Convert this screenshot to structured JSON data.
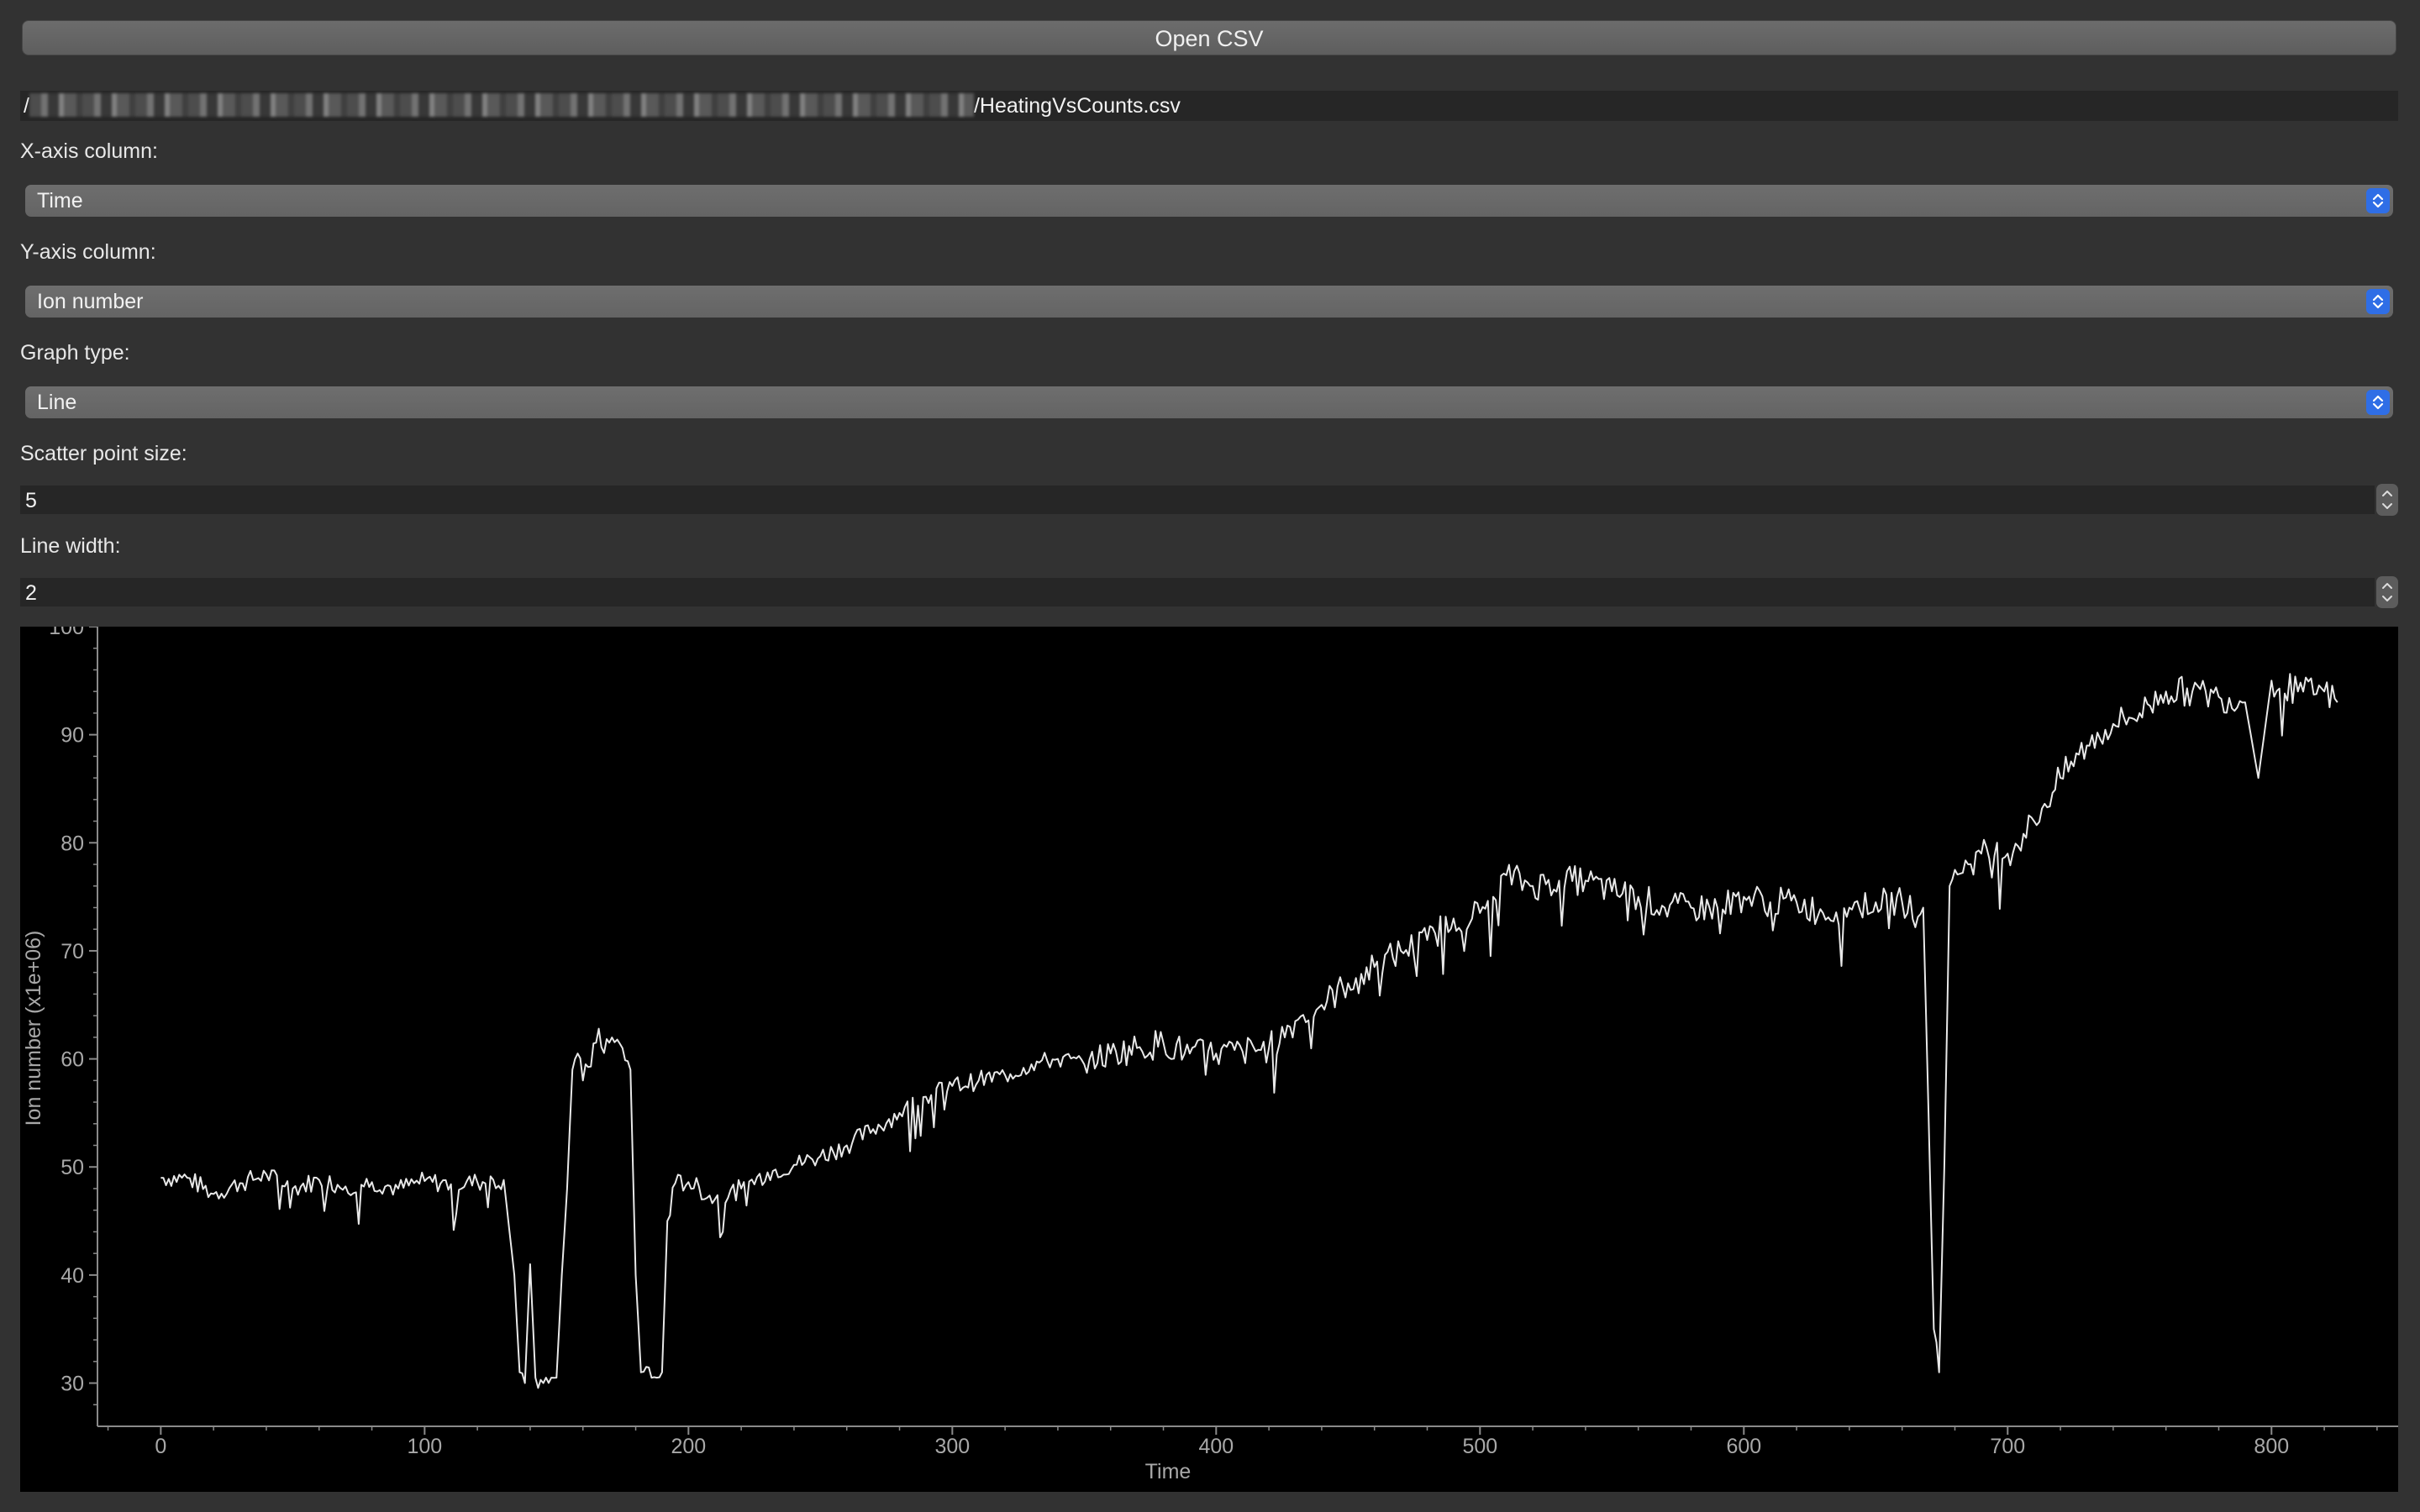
{
  "toolbar": {
    "open_label": "Open CSV"
  },
  "file": {
    "path_prefix": "/",
    "path_suffix": "/HeatingVsCounts.csv"
  },
  "x_axis": {
    "label": "X-axis column:",
    "value": "Time"
  },
  "y_axis": {
    "label": "Y-axis column:",
    "value": "Ion number"
  },
  "graph_type": {
    "label": "Graph type:",
    "value": "Line"
  },
  "scatter_size": {
    "label": "Scatter point size:",
    "value": "5"
  },
  "line_width": {
    "label": "Line width:",
    "value": "2"
  },
  "colors": {
    "accent": "#2f6ee6",
    "plot_bg": "#000000",
    "line": "#e8e8e8"
  },
  "chart_data": {
    "type": "line",
    "xlabel": "Time",
    "ylabel": "Ion number (x1e+06)",
    "xlim": [
      -24,
      848
    ],
    "ylim": [
      26,
      100
    ],
    "x_ticks": [
      0,
      100,
      200,
      300,
      400,
      500,
      600,
      700,
      800
    ],
    "y_ticks": [
      30,
      40,
      50,
      60,
      70,
      80,
      90,
      100
    ],
    "grid": false,
    "series": [
      {
        "x": [
          0,
          10,
          20,
          30,
          40,
          50,
          60,
          70,
          80,
          90,
          100,
          110,
          120,
          130,
          134,
          136,
          138,
          140,
          142,
          144,
          146,
          148,
          150,
          152,
          154,
          156,
          158,
          160,
          165,
          170,
          175,
          178,
          180,
          182,
          184,
          186,
          188,
          190,
          192,
          195,
          200,
          210,
          220,
          230,
          240,
          250,
          260,
          270,
          280,
          290,
          300,
          310,
          320,
          330,
          340,
          350,
          360,
          370,
          380,
          390,
          400,
          410,
          420,
          430,
          440,
          450,
          460,
          470,
          480,
          490,
          500,
          505,
          510,
          520,
          530,
          540,
          550,
          560,
          570,
          580,
          590,
          600,
          610,
          620,
          630,
          640,
          650,
          660,
          668,
          670,
          672,
          674,
          676,
          678,
          680,
          685,
          690,
          700,
          710,
          720,
          730,
          740,
          750,
          760,
          770,
          780,
          790,
          795,
          800,
          810,
          820,
          825
        ],
        "y": [
          49,
          49,
          47.5,
          48.5,
          49.3,
          48,
          48.8,
          48.2,
          48.6,
          48,
          48.7,
          48.4,
          48.6,
          48.8,
          40,
          31,
          30,
          41,
          30.5,
          30.3,
          30.5,
          30.5,
          30.5,
          40,
          48,
          59,
          60.5,
          58,
          61.5,
          61.5,
          61,
          59,
          40,
          31,
          31.5,
          30.5,
          30.5,
          31,
          45,
          48.5,
          48.6,
          47,
          48,
          49.5,
          50.2,
          51,
          52,
          53.5,
          55,
          56.5,
          57.5,
          58,
          58.5,
          59.5,
          60,
          59.5,
          60.5,
          61,
          61.5,
          60.5,
          60.5,
          60.7,
          61,
          63.5,
          65,
          67,
          68.5,
          70,
          71,
          73,
          73.5,
          75,
          77,
          76,
          76.5,
          76.5,
          75.5,
          75,
          74,
          74,
          74,
          75,
          74.5,
          74.5,
          73.5,
          74,
          74.5,
          74.5,
          74,
          55,
          35,
          31,
          50,
          76,
          77.5,
          78,
          79,
          79,
          82,
          86,
          89,
          91,
          92,
          94,
          94,
          93.5,
          93,
          86,
          95,
          94,
          94,
          93
        ]
      }
    ]
  }
}
